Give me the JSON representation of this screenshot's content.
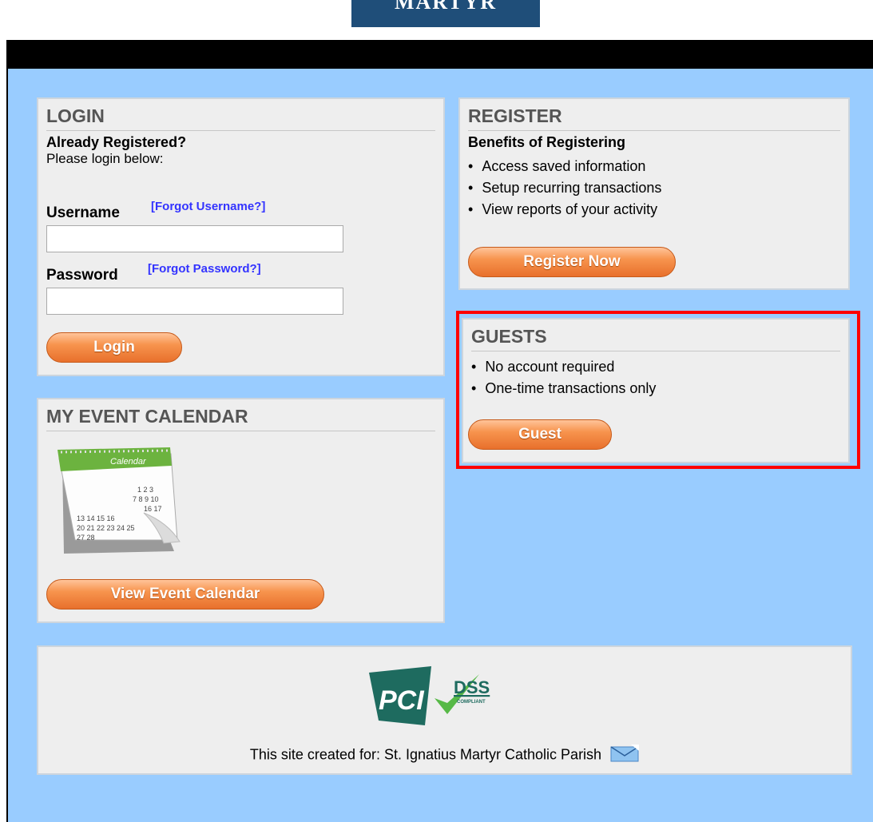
{
  "logo": {
    "text": "MARTYR"
  },
  "login": {
    "title": "LOGIN",
    "already_registered": "Already Registered?",
    "instruction": "Please login below:",
    "username_label": "Username",
    "forgot_username": "[Forgot Username?]",
    "username_value": "",
    "password_label": "Password",
    "forgot_password": "[Forgot Password?]",
    "password_value": "",
    "login_button": "Login"
  },
  "register": {
    "title": "REGISTER",
    "subtitle": "Benefits of Registering",
    "benefits": [
      "Access saved information",
      "Setup recurring transactions",
      "View reports of your activity"
    ],
    "button": "Register Now"
  },
  "guests": {
    "title": "GUESTS",
    "items": [
      "No account required",
      "One-time transactions only"
    ],
    "button": "Guest"
  },
  "calendar": {
    "title": "MY EVENT CALENDAR",
    "image_label": "Calendar",
    "button": "View Event Calendar"
  },
  "footer": {
    "pci_text": "PCI",
    "dss_text": "DSS",
    "compliant_text": "COMPLIANT",
    "created_for": "This site created for: St. Ignatius Martyr Catholic Parish",
    "email_icon": "envelope-icon"
  },
  "colors": {
    "accent_orange": "#f7944e",
    "page_blue": "#99ccff",
    "highlight_red": "#ff0000",
    "link_blue": "#3333ff"
  }
}
